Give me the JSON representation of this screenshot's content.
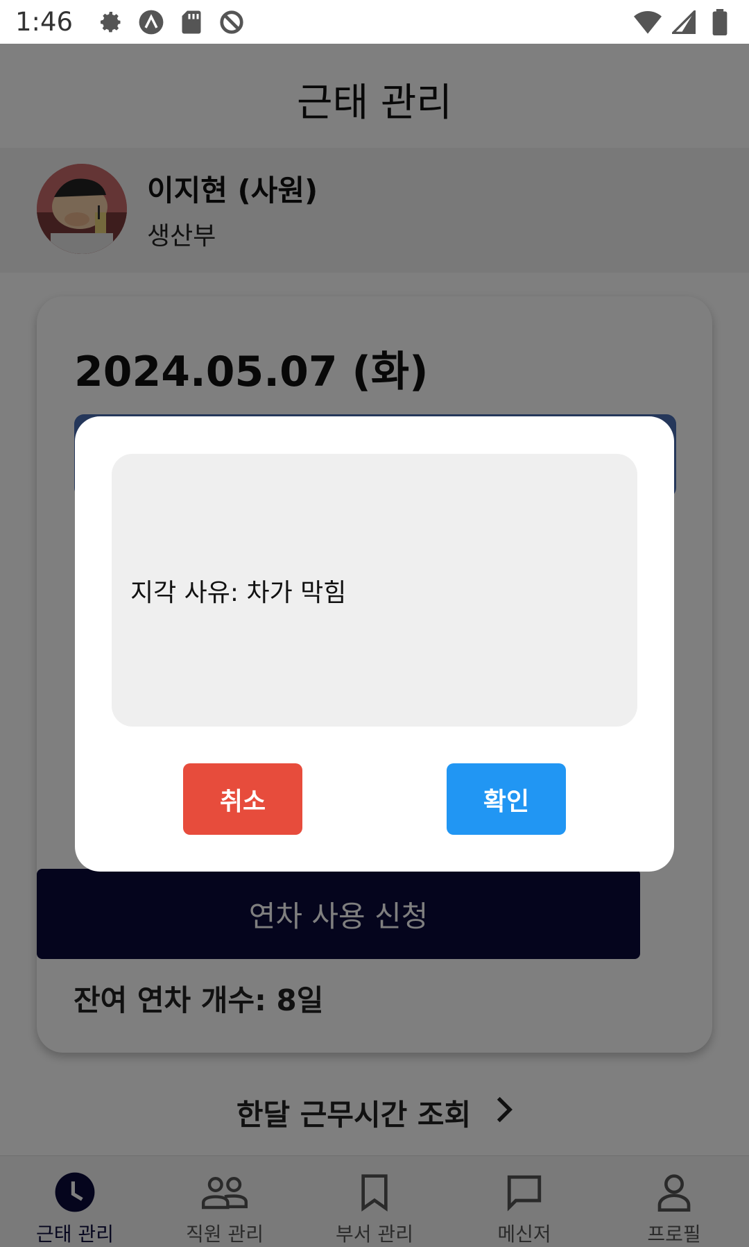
{
  "status_bar": {
    "time": "1:46"
  },
  "app_bar": {
    "title": "근태 관리"
  },
  "user": {
    "name": "이지현 (사원)",
    "department": "생산부"
  },
  "card": {
    "date": "2024.05.07  (화)",
    "apply_leave_label": "연차 사용 신청",
    "remaining_leave": "잔여 연차 개수: 8일"
  },
  "monthly_link": {
    "label": "한달 근무시간 조회"
  },
  "nav": {
    "items": [
      {
        "label": "근태 관리",
        "icon": "clock-icon",
        "active": true
      },
      {
        "label": "직원 관리",
        "icon": "people-icon",
        "active": false
      },
      {
        "label": "부서 관리",
        "icon": "bookmark-icon",
        "active": false
      },
      {
        "label": "메신저",
        "icon": "chat-icon",
        "active": false
      },
      {
        "label": "프로필",
        "icon": "person-icon",
        "active": false
      }
    ]
  },
  "dialog": {
    "reason": "지각 사유: 차가 막힘",
    "cancel_label": "취소",
    "confirm_label": "확인"
  },
  "colors": {
    "primary": "#0a0a3a",
    "cancel": "#e74c3c",
    "confirm": "#2196f3"
  }
}
